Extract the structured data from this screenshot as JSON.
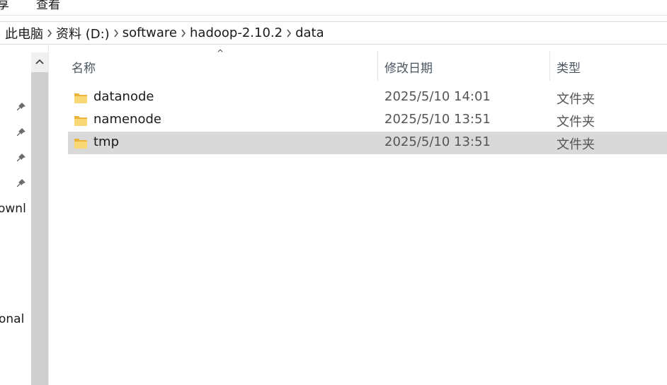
{
  "ribbon": {
    "tabs": [
      {
        "label": "享"
      },
      {
        "label": "查看"
      }
    ]
  },
  "address": {
    "crumbs": [
      {
        "label": "此电脑"
      },
      {
        "label": "资料 (D:)"
      },
      {
        "label": "software"
      },
      {
        "label": "hadoop-2.10.2"
      },
      {
        "label": "data"
      }
    ]
  },
  "nav": {
    "items": [
      {
        "label": "ownl"
      },
      {
        "label": "onal"
      }
    ]
  },
  "columns": {
    "name": "名称",
    "modified": "修改日期",
    "type": "类型",
    "sort_indicator": "^"
  },
  "files": [
    {
      "name": "datanode",
      "modified": "2025/5/10 14:01",
      "type": "文件夹",
      "selected": false
    },
    {
      "name": "namenode",
      "modified": "2025/5/10 13:51",
      "type": "文件夹",
      "selected": false
    },
    {
      "name": "tmp",
      "modified": "2025/5/10 13:51",
      "type": "文件夹",
      "selected": true
    }
  ],
  "colors": {
    "selection": "#d9d9d9",
    "folder": "#f5c542",
    "header_text": "#4a5560"
  }
}
